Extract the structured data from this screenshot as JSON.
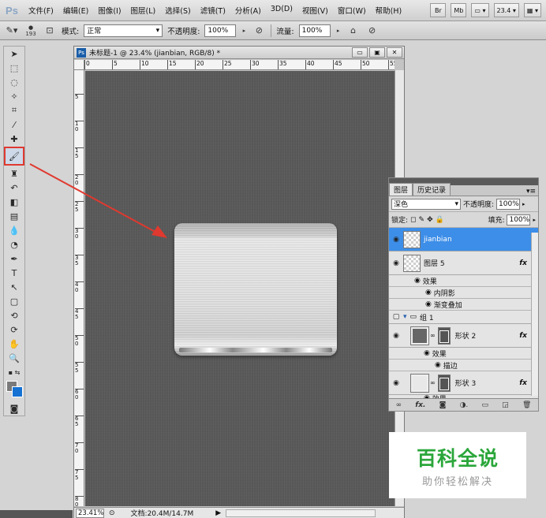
{
  "app": {
    "logo": "Ps"
  },
  "menu": {
    "items": [
      "文件(F)",
      "编辑(E)",
      "图像(I)",
      "图层(L)",
      "选择(S)",
      "滤镜(T)",
      "分析(A)",
      "3D(D)",
      "视图(V)",
      "窗口(W)",
      "帮助(H)"
    ],
    "right": {
      "btn1": "Br",
      "btn2": "Mb",
      "zoom": "23.4",
      "layout_icon": "layout-icon"
    }
  },
  "options": {
    "brush_size": "193",
    "mode_label": "模式:",
    "mode_value": "正常",
    "opacity_label": "不透明度:",
    "opacity_value": "100%",
    "flow_label": "流量:",
    "flow_value": "100%"
  },
  "document": {
    "title": "未标题-1 @ 23.4% (jianbian, RGB/8) *",
    "ruler_h": [
      "0",
      "5",
      "10",
      "15",
      "20",
      "25",
      "30",
      "35",
      "40",
      "45",
      "50",
      "55"
    ],
    "ruler_v": [
      "5",
      "1 0",
      "1 5",
      "2 0",
      "2 5",
      "3 0",
      "3 5",
      "4 0",
      "4 5",
      "5 0",
      "5 5",
      "6 0",
      "6 5",
      "7 0",
      "7 5",
      "8 0"
    ],
    "zoom": "23.41%",
    "doc_size": "文档:20.4M/14.7M"
  },
  "layers_panel": {
    "tab_layers": "图层",
    "tab_history": "历史记录",
    "blend_mode": "深色",
    "opacity_label": "不透明度:",
    "opacity_value": "100%",
    "lock_label": "锁定:",
    "fill_label": "填充:",
    "fill_value": "100%",
    "fx_label": "fx",
    "layers": [
      {
        "name": "jianbian",
        "selected": true
      },
      {
        "name": "图层 5",
        "effects_label": "效果",
        "effects": [
          "内阴影",
          "渐变叠加"
        ]
      },
      {
        "name": "组 1",
        "type": "group"
      },
      {
        "name": "形状 2",
        "effects_label": "效果",
        "effects": [
          "描边"
        ]
      },
      {
        "name": "形状 3",
        "effects_label": "效果"
      }
    ]
  },
  "watermark": {
    "title": "百科全说",
    "subtitle": "助你轻松解决"
  },
  "colors": {
    "accent_red": "#e0392f",
    "selected_layer": "#3d8ee8",
    "watermark_green": "#2aa63a",
    "background_swatch": "#1572d3"
  }
}
